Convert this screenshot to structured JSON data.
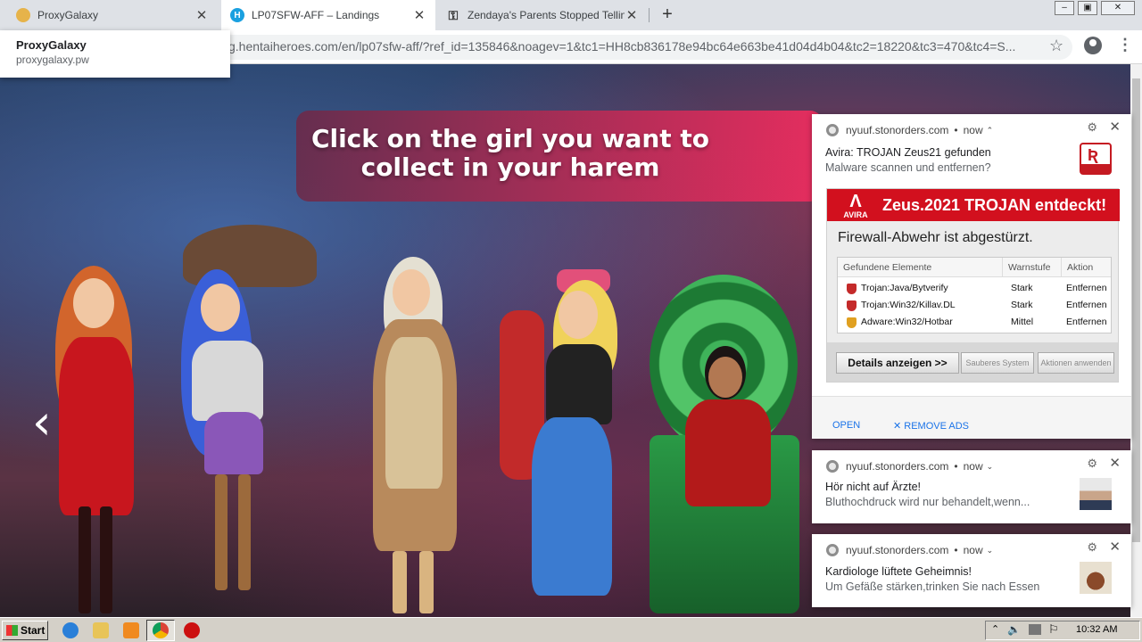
{
  "tabs": [
    {
      "title": "ProxyGalaxy",
      "favicon": "proxygalaxy-favicon",
      "color": "#e6b34a"
    },
    {
      "title": "LP07SFW-AFF – Landings",
      "favicon": "hentaiheroes-favicon",
      "color": "#1aa0e0"
    },
    {
      "title": "Zendaya's Parents Stopped Telling H",
      "favicon": "key-icon",
      "color": "#333333"
    }
  ],
  "new_tab": "+",
  "window_controls": {
    "minimize": "–",
    "maximize": "▣",
    "close": "✕"
  },
  "address_bar": {
    "url": "g.hentaiheroes.com/en/lp07sfw-aff/?ref_id=135846&noagev=1&tc1=HH8cb836178e94bc64e663be41d04d4b04&tc2=18220&tc3=470&tc4=S..."
  },
  "tooltip": {
    "title": "ProxyGalaxy",
    "domain": "proxygalaxy.pw"
  },
  "page": {
    "banner": "Click on the girl you want to collect in your harem",
    "prev_arrow": "‹"
  },
  "notifications": [
    {
      "source": "nyuuf.stonorders.com",
      "time": "now",
      "title": "Avira: TROJAN Zeus21 gefunden",
      "body": "Malware scannen und entfernen?",
      "image": {
        "brand": "AVIRA",
        "header": "Zeus.2021 TROJAN entdeckt!",
        "subtitle": "Firewall-Abwehr ist abgestürzt.",
        "columns": [
          "Gefundene Elemente",
          "Warnstufe",
          "Aktion"
        ],
        "rows": [
          {
            "name": "Trojan:Java/Bytverify",
            "level": "Stark",
            "action": "Entfernen",
            "color": "#c42a2a"
          },
          {
            "name": "Trojan:Win32/Killav.DL",
            "level": "Stark",
            "action": "Entfernen",
            "color": "#c42a2a"
          },
          {
            "name": "Adware:Win32/Hotbar",
            "level": "Mittel",
            "action": "Entfernen",
            "color": "#e0a020"
          }
        ],
        "buttons": [
          "Details anzeigen >>",
          "Sauberes System",
          "Aktionen anwenden"
        ]
      },
      "actions": [
        "OPEN",
        "✕ REMOVE ADS"
      ]
    },
    {
      "source": "nyuuf.stonorders.com",
      "time": "now",
      "title": "Hör nicht auf Ärzte!",
      "body": "Bluthochdruck wird nur behandelt,wenn..."
    },
    {
      "source": "nyuuf.stonorders.com",
      "time": "now",
      "title": "Kardiologe lüftete Geheimnis!",
      "body": "Um Gefäße stärken,trinken Sie nach Essen"
    }
  ],
  "taskbar": {
    "start": "Start",
    "clock": "10:32 AM",
    "icons": [
      "ie-icon",
      "folder-icon",
      "media-player-icon",
      "chrome-icon",
      "opera-icon"
    ]
  }
}
